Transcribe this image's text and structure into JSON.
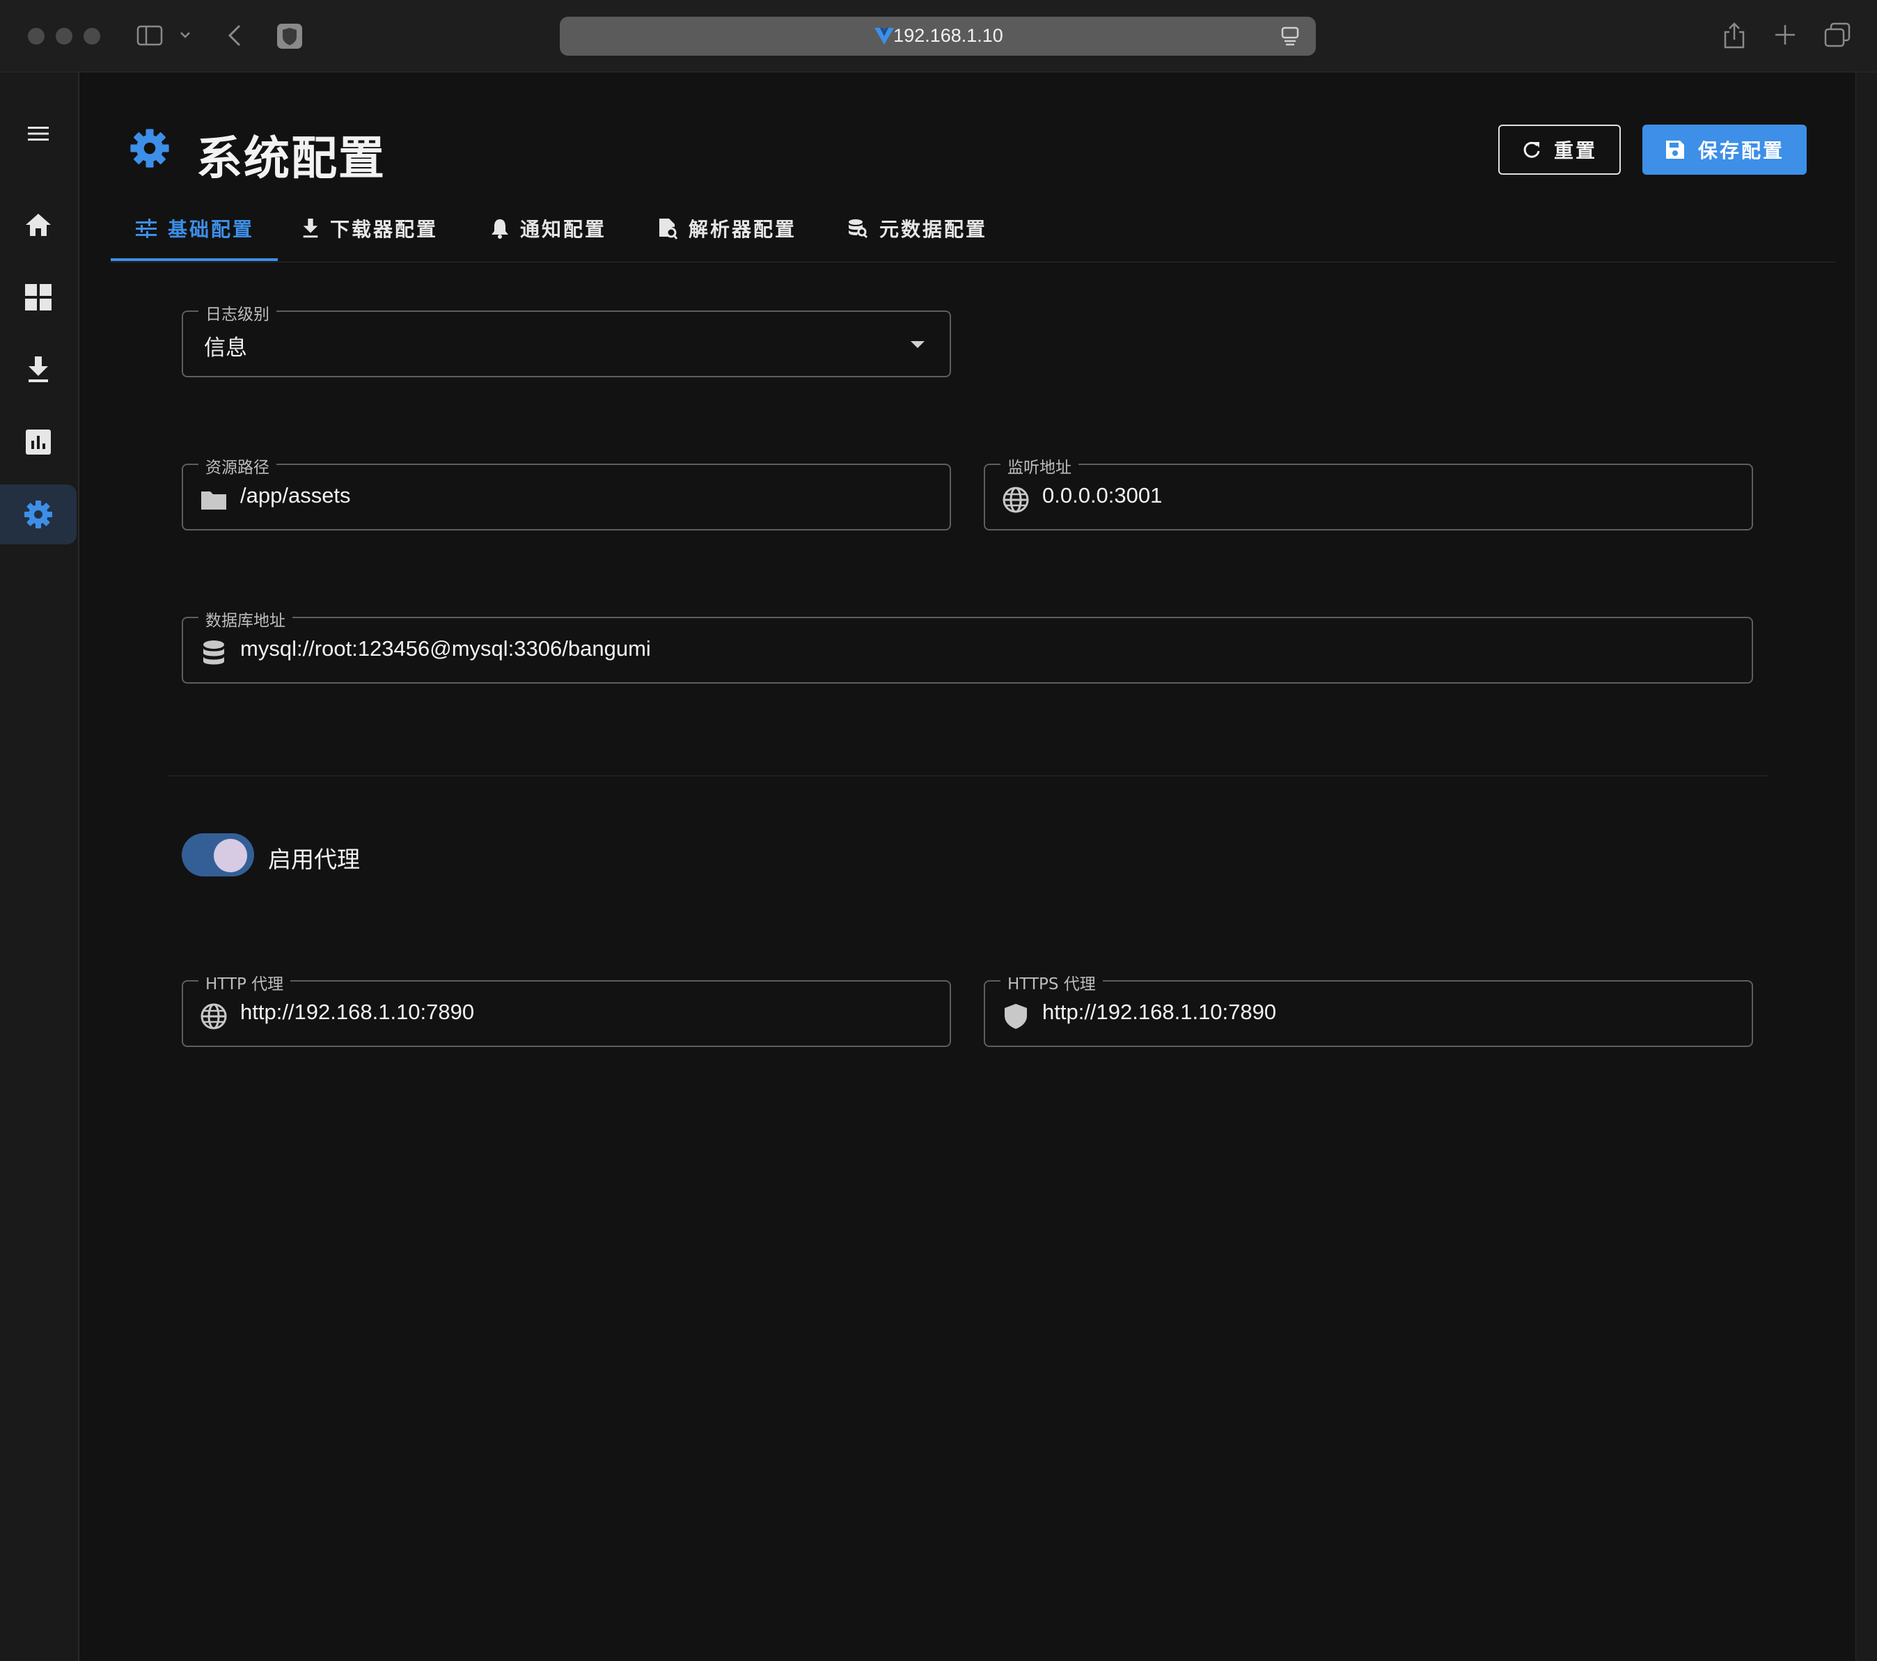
{
  "browser": {
    "address": "192.168.1.10"
  },
  "sidebar": {
    "items": [
      {
        "name": "menu",
        "icon": "menu-icon"
      },
      {
        "name": "home",
        "icon": "home-icon"
      },
      {
        "name": "dashboard",
        "icon": "grid-icon"
      },
      {
        "name": "downloads",
        "icon": "download-icon"
      },
      {
        "name": "stats",
        "icon": "bar-chart-icon"
      },
      {
        "name": "settings",
        "icon": "gear-icon",
        "active": true
      }
    ]
  },
  "header": {
    "title": "系统配置",
    "reset_label": "重置",
    "save_label": "保存配置"
  },
  "tabs": [
    {
      "label": "基础配置",
      "icon": "sliders-icon",
      "active": true
    },
    {
      "label": "下载器配置",
      "icon": "download-icon"
    },
    {
      "label": "通知配置",
      "icon": "bell-icon"
    },
    {
      "label": "解析器配置",
      "icon": "file-search-icon"
    },
    {
      "label": "元数据配置",
      "icon": "database-search-icon"
    }
  ],
  "form": {
    "log_level": {
      "label": "日志级别",
      "value": "信息"
    },
    "asset_path": {
      "label": "资源路径",
      "value": "/app/assets"
    },
    "listen_addr": {
      "label": "监听地址",
      "value": "0.0.0.0:3001"
    },
    "db_url": {
      "label": "数据库地址",
      "value": "mysql://root:123456@mysql:3306/bangumi"
    },
    "proxy_toggle": {
      "label": "启用代理",
      "enabled": true
    },
    "http_proxy": {
      "label": "HTTP 代理",
      "value": "http://192.168.1.10:7890"
    },
    "https_proxy": {
      "label": "HTTPS 代理",
      "value": "http://192.168.1.10:7890"
    }
  },
  "colors": {
    "accent": "#3d8fe8",
    "background": "#121212",
    "toggle_track": "#335f96"
  }
}
